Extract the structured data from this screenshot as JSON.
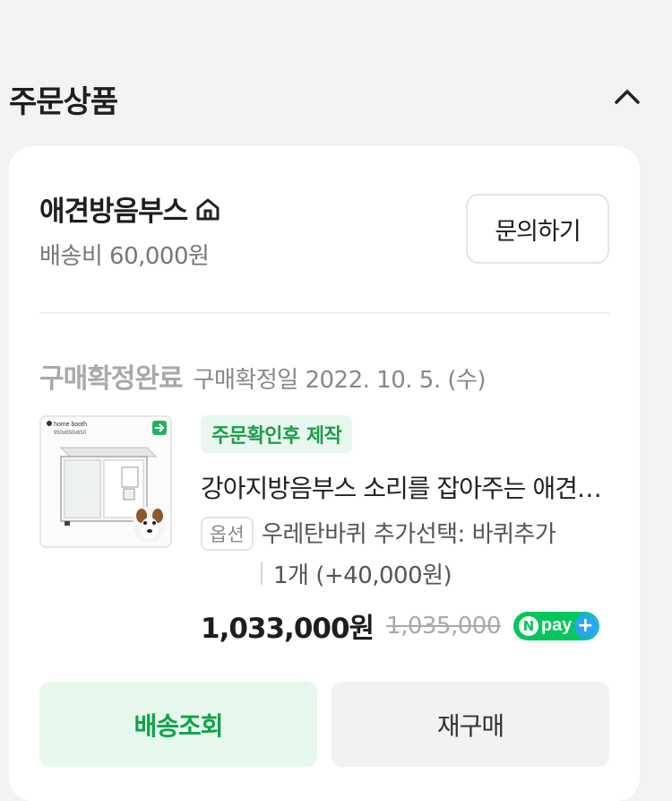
{
  "section": {
    "title": "주문상품",
    "collapse_icon": "chevron-up-icon"
  },
  "store": {
    "name": "애견방음부스",
    "home_icon": "home-icon",
    "shipping_fee": "배송비 60,000원",
    "inquiry_label": "문의하기"
  },
  "order": {
    "status": "구매확정완료",
    "confirm_date": "구매확정일 2022. 10. 5. (수)"
  },
  "product": {
    "thumbnail": {
      "brand": "home booth",
      "size": "950x650x650"
    },
    "badge": "주문확인후 제작",
    "title": "강아지방음부스 소리를 잡아주는 애견방음부스",
    "option_tag": "옵션",
    "option_text": "우레탄바퀴 추가선택: 바퀴추가",
    "option_qty": "1개 (+40,000원)",
    "price": "1,033,000원",
    "original_price": "1,035,000",
    "npay_label": "pay"
  },
  "actions": {
    "track_label": "배송조회",
    "rebuy_label": "재구매"
  },
  "colors": {
    "accent_green": "#1e9c4b",
    "npay_green": "#03c75a",
    "npay_blue": "#2aa4f4"
  }
}
